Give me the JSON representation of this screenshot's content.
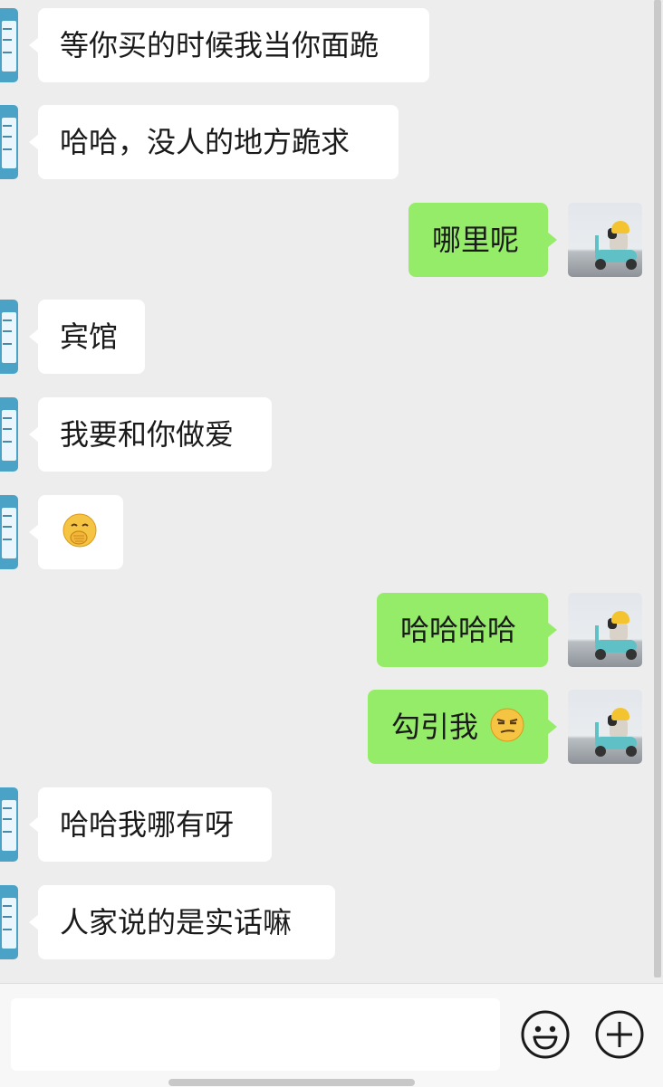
{
  "messages": [
    {
      "side": "in",
      "text": "等你买的时候我当你面跪"
    },
    {
      "side": "in",
      "text": "哈哈，没人的地方跪求"
    },
    {
      "side": "out",
      "text": "哪里呢"
    },
    {
      "side": "in",
      "text": "宾馆"
    },
    {
      "side": "in",
      "text": "我要和你做爱"
    },
    {
      "side": "in",
      "emoji": "face-with-hand-over-mouth"
    },
    {
      "side": "out",
      "text": "哈哈哈哈"
    },
    {
      "side": "out",
      "text": "勾引我",
      "emoji": "smirking-face"
    },
    {
      "side": "in",
      "text": "哈哈我哪有呀"
    },
    {
      "side": "in",
      "text": "人家说的是实话嘛"
    }
  ],
  "input_bar": {
    "placeholder": "",
    "emoji_button_icon": "smiley-icon",
    "add_button_icon": "plus-icon"
  },
  "colors": {
    "background": "#ededed",
    "bubble_in": "#ffffff",
    "bubble_out": "#95ec69",
    "text": "#1a1a1a"
  }
}
